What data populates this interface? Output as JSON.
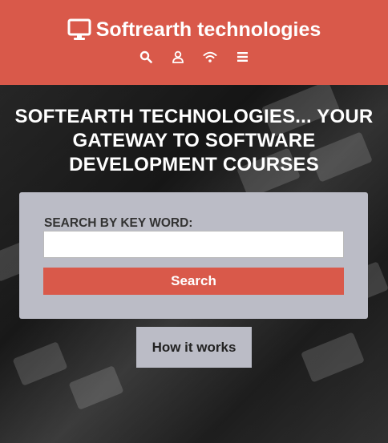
{
  "header": {
    "brand_icon": "monitor-icon",
    "brand_name": "Softrearth technologies",
    "background_color": "#d9594a",
    "nav_icons": [
      "search-icon",
      "user-icon",
      "wifi-icon",
      "menu-icon"
    ]
  },
  "hero": {
    "headline_line1": "SOFTEARTH TECHNOLOGIES... YOUR",
    "headline_line2": "GATEWAY TO SOFTWARE",
    "headline_line3": "DEVELOPMENT COURSES"
  },
  "search": {
    "label": "SEARCH BY KEY WORD:",
    "value": "",
    "placeholder": "",
    "button_label": "Search",
    "button_color": "#d9594a"
  },
  "how_it_works": {
    "label": "How it works"
  }
}
